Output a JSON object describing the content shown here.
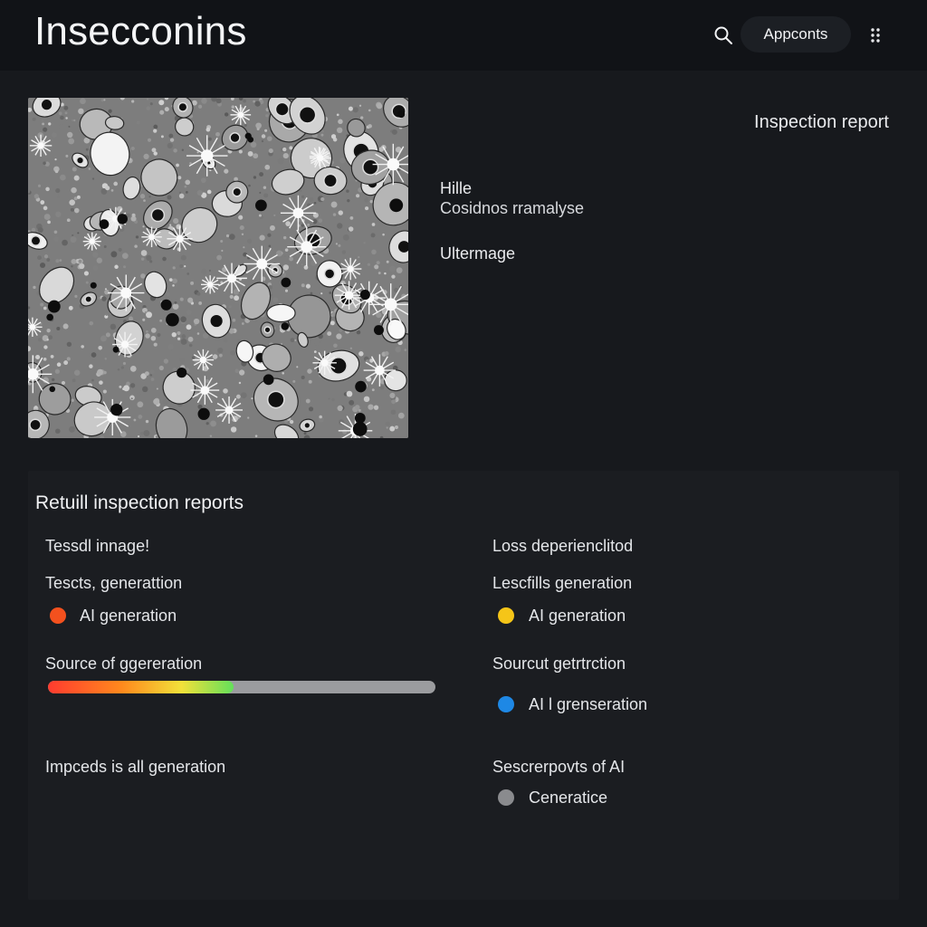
{
  "header": {
    "title": "Insecconins",
    "accounts_label": "Appconts",
    "icons": [
      "search-icon",
      "more-vert-icon"
    ]
  },
  "top": {
    "report_link": "Inspection report",
    "meta": [
      "Hille",
      "Cosidnos rramalyse",
      "Ultermage"
    ]
  },
  "panel": {
    "title": "Retuill inspection reports",
    "left": {
      "row1": "Tessdl innage!",
      "row2": "Tescts, generattion",
      "status1": {
        "label": "AI generation",
        "color": "#f4511e"
      },
      "bar_label": "Source of ggereration",
      "bar_level": 0.48,
      "row3": "Impceds is all generation"
    },
    "right": {
      "row1": "Loss deperienclitod",
      "row2": "Lescfills generation",
      "status1": {
        "label": "AI generation",
        "color": "#f5c518"
      },
      "row3": "Sourcut getrtrction",
      "status2": {
        "label": "AI l grenseration",
        "color": "#1e88e5"
      },
      "row4": "Sescrerpovts of AI",
      "status3": {
        "label": "Ceneratice",
        "color": "#8a8b8e"
      }
    }
  }
}
